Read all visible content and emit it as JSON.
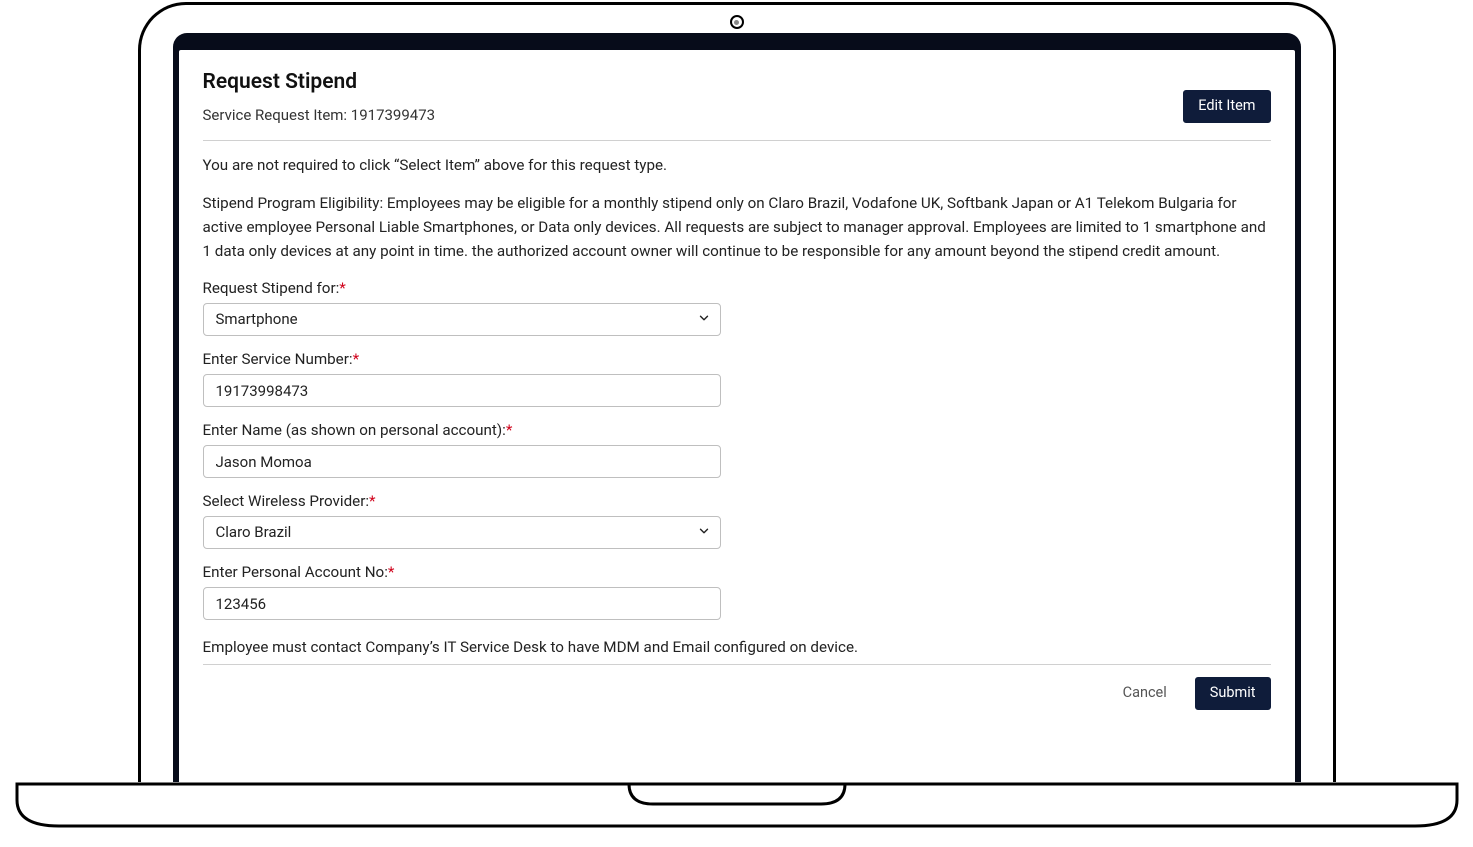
{
  "header": {
    "title": "Request Stipend",
    "request_item_label": "Service Request Item: 1917399473",
    "edit_button": "Edit Item"
  },
  "intro": {
    "note": "You are not required to click “Select Item” above for this request type.",
    "eligibility": "Stipend Program Eligibility: Employees may be eligible for a monthly stipend only on Claro Brazil, Vodafone UK, Softbank Japan or A1 Telekom Bulgaria for active employee Personal Liable Smartphones, or Data only devices. All requests are subject to manager approval. Employees are limited to 1 smartphone and 1 data only devices at any point in time. the authorized account owner will continue to be responsible for any amount beyond the stipend credit amount."
  },
  "form": {
    "stipend_for": {
      "label": "Request Stipend for:",
      "value": "Smartphone"
    },
    "service_number": {
      "label": "Enter Service Number:",
      "value": "19173998473"
    },
    "name": {
      "label": "Enter Name (as shown on personal account):",
      "value": "Jason Momoa"
    },
    "provider": {
      "label": "Select Wireless Provider:",
      "value": "Claro Brazil"
    },
    "account_no": {
      "label": "Enter Personal Account No:",
      "value": "123456"
    }
  },
  "footer": {
    "note": "Employee must contact Company’s IT Service Desk to have MDM and Email configured on device.",
    "cancel": "Cancel",
    "submit": "Submit"
  },
  "required_marker": "*"
}
